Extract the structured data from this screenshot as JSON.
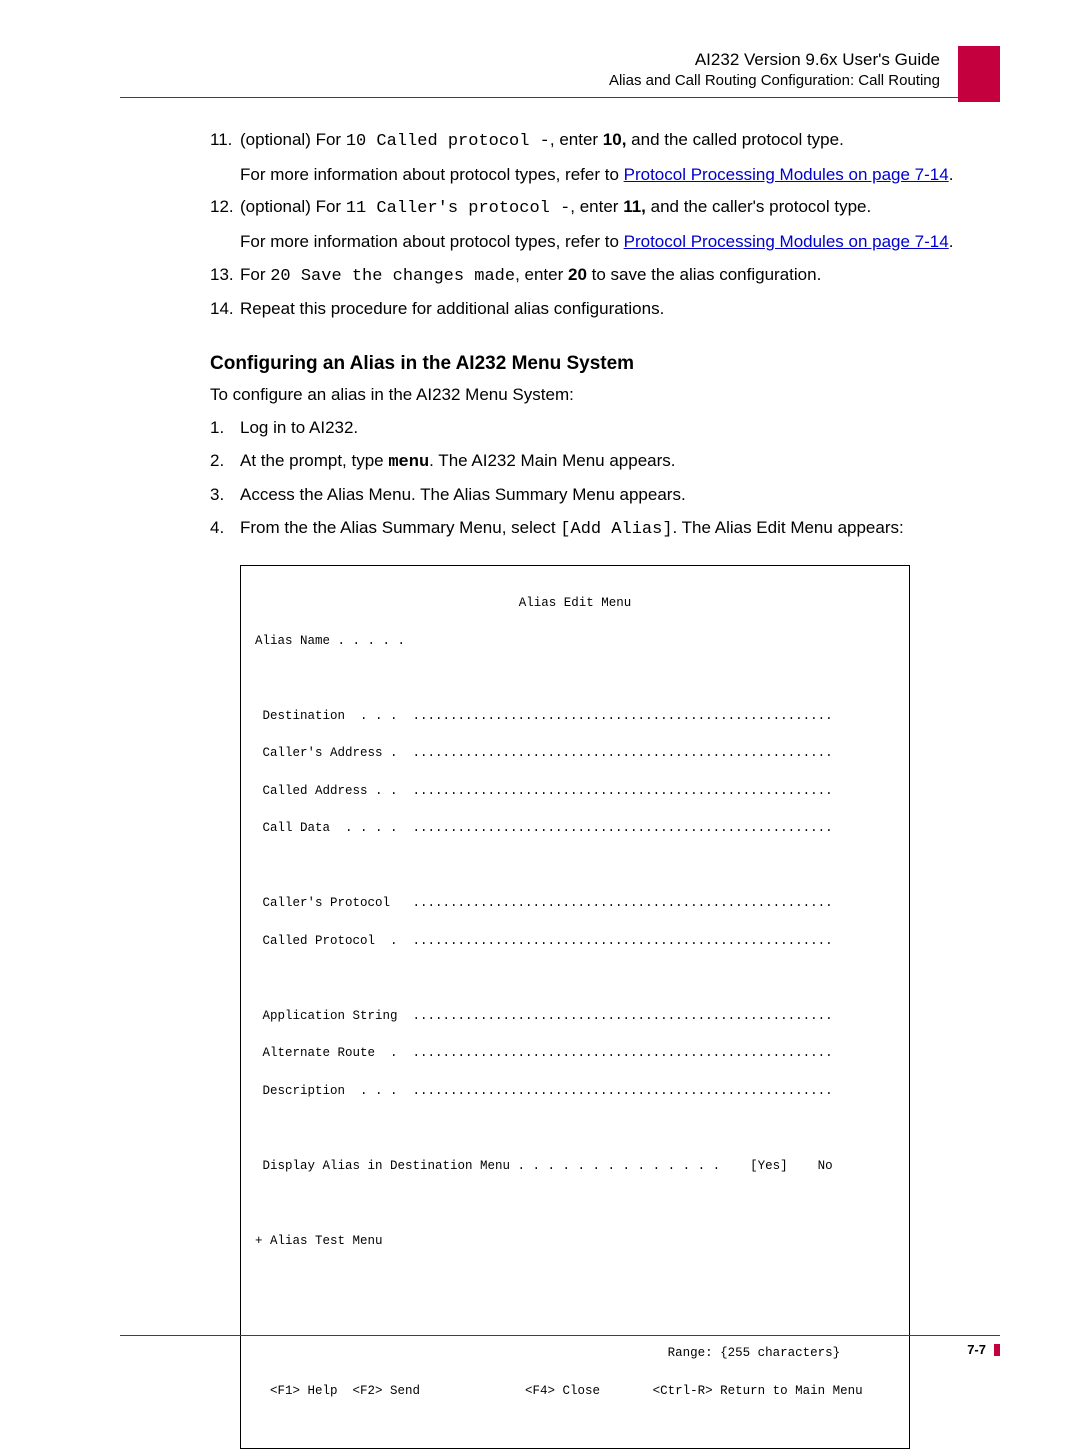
{
  "header": {
    "title": "AI232 Version 9.6x User's Guide",
    "subtitle": "Alias and Call Routing Configuration: Call Routing"
  },
  "steps": {
    "s11_prefix": "(optional) For ",
    "s11_code": "10 Called protocol -",
    "s11_mid": ", enter ",
    "s11_bold": "10,",
    "s11_suffix": "  and the called protocol type.",
    "s11_body_prefix": "For more information about protocol types, refer to ",
    "link_text": "Protocol Processing Modules on page 7-14",
    "s12_prefix": "(optional) For ",
    "s12_code": "11 Caller's protocol -",
    "s12_mid": ", enter ",
    "s12_bold": "11,",
    "s12_suffix": "  and the caller's protocol type.",
    "s13_prefix": "For ",
    "s13_code": "20 Save the changes made",
    "s13_mid": ", enter ",
    "s13_bold": "20",
    "s13_suffix": " to save the alias configuration.",
    "s14": "Repeat this procedure for additional alias configurations."
  },
  "section": {
    "heading": "Configuring an Alias in the AI232 Menu System",
    "intro": "To configure an alias in the AI232 Menu System:",
    "step1": "Log in to AI232.",
    "step2_prefix": "At the prompt, type ",
    "step2_code": "menu",
    "step2_suffix": ". The AI232 Main Menu appears.",
    "step3": "Access the Alias Menu. The Alias Summary Menu appears.",
    "step4_prefix": "From the the Alias Summary Menu, select ",
    "step4_code": "[Add Alias]",
    "step4_suffix": ". The Alias Edit Menu appears:"
  },
  "menu": {
    "title": "Alias Edit Menu",
    "alias_name": "Alias Name . . . . .",
    "destination": " Destination  . . .  ........................................................",
    "callers_addr": " Caller's Address .  ........................................................",
    "called_addr": " Called Address . .  ........................................................",
    "call_data": " Call Data  . . . .  ........................................................",
    "callers_proto": " Caller's Protocol   ........................................................",
    "called_proto": " Called Protocol  .  ........................................................",
    "app_string": " Application String  ........................................................",
    "alt_route": " Alternate Route  .  ........................................................",
    "description": " Description  . . .  ........................................................",
    "display_line": " Display Alias in Destination Menu . . . . . . . . . . . . . .    [Yes]    No",
    "test_menu": "+ Alias Test Menu",
    "range": "                                                       Range: {255 characters}",
    "footer": "  <F1> Help  <F2> Send              <F4> Close       <Ctrl-R> Return to Main Menu"
  },
  "page_number": "7-7"
}
